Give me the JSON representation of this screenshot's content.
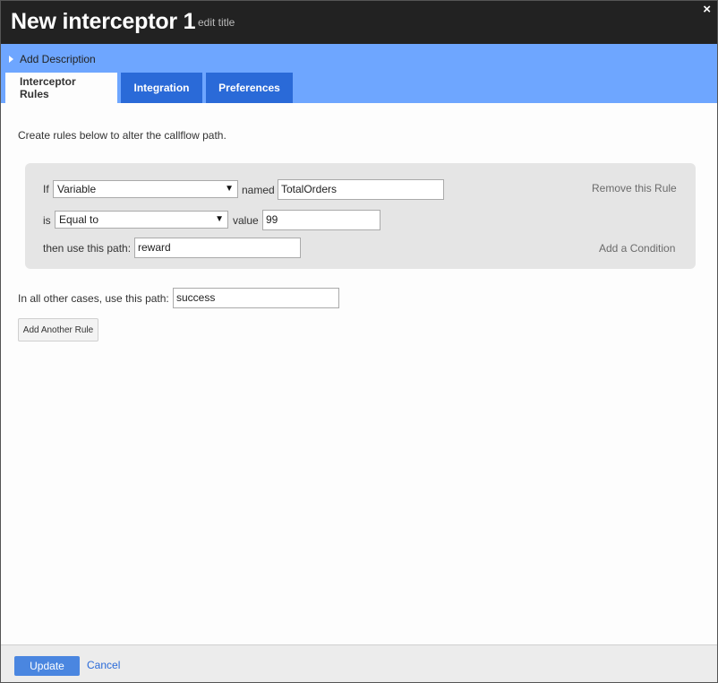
{
  "dialog": {
    "title": "New interceptor 1",
    "edit_title": "edit title",
    "close_glyph": "×"
  },
  "description": {
    "toggle_label": "Add Description"
  },
  "tabs": [
    {
      "label": "Interceptor Rules",
      "active": true
    },
    {
      "label": "Integration",
      "active": false
    },
    {
      "label": "Preferences",
      "active": false
    }
  ],
  "rules_intro": "Create rules below to alter the callflow path.",
  "rule": {
    "if_label": "If",
    "source_select": "Variable",
    "named_label": "named",
    "named_value": "TotalOrders",
    "remove_label": "Remove this Rule",
    "is_label": "is",
    "operator_select": "Equal to",
    "value_label": "value",
    "value_value": "99",
    "path_label": "then use this path:",
    "path_value": "reward",
    "add_condition_label": "Add a Condition"
  },
  "other_cases": {
    "label": "In all other cases, use this path:",
    "value": "success"
  },
  "add_rule_button": "Add Another Rule",
  "footer": {
    "update_label": "Update",
    "cancel_label": "Cancel"
  },
  "colors": {
    "titlebar": "#222222",
    "descbar": "#6ea6ff",
    "tab_inactive": "#2a6ad8",
    "update_button": "#4a86e0"
  },
  "icons": {
    "close": "close-icon",
    "disclosure": "triangle-right-icon",
    "dropdown": "chevron-down-icon"
  }
}
